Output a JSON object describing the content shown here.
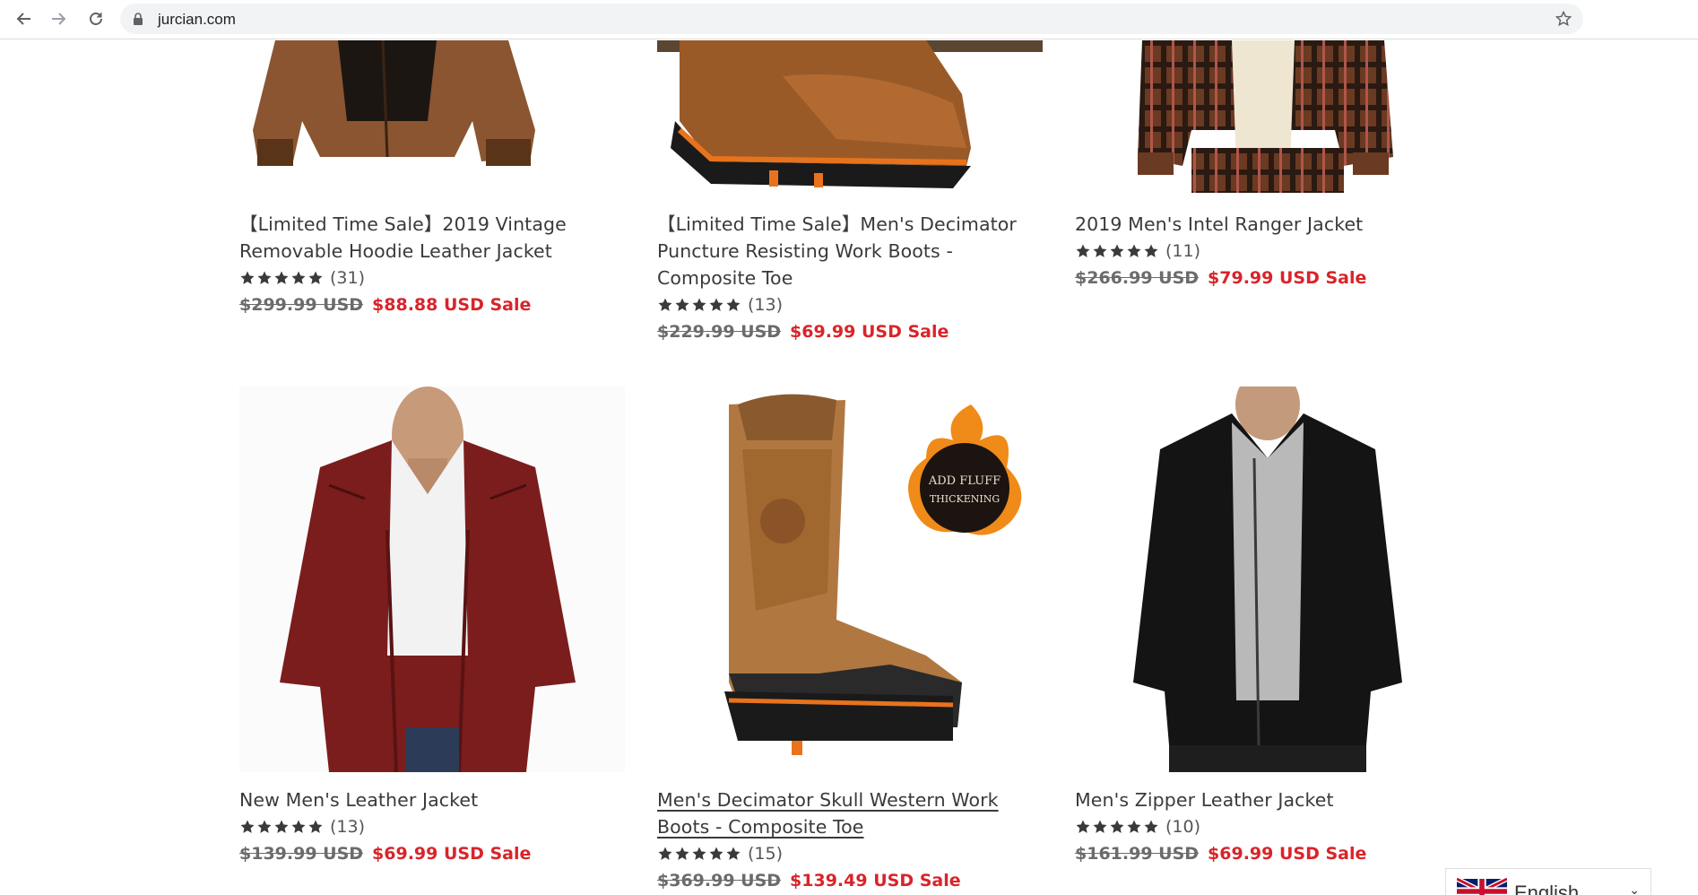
{
  "browser": {
    "url": "jurcian.com",
    "back_icon": "arrow-left-icon",
    "forward_icon": "arrow-right-icon",
    "reload_icon": "reload-icon",
    "lock_icon": "lock-icon",
    "bookmark_icon": "star-outline-icon"
  },
  "products": [
    {
      "title": "【Limited Time Sale】2019 Vintage Removable Hoodie Leather Jacket",
      "rating": 5,
      "reviews": "(31)",
      "was": "$299.99 USD",
      "now": "$88.88 USD Sale"
    },
    {
      "title": "【Limited Time Sale】Men's Decimator Puncture Resisting Work Boots - Composite Toe",
      "rating": 5,
      "reviews": "(13)",
      "was": "$229.99 USD",
      "now": "$69.99 USD Sale"
    },
    {
      "title": "2019 Men's Intel Ranger Jacket",
      "rating": 5,
      "reviews": "(11)",
      "was": "$266.99 USD",
      "now": "$79.99 USD Sale"
    },
    {
      "title": "New Men's Leather Jacket",
      "rating": 5,
      "reviews": "(13)",
      "was": "$139.99 USD",
      "now": "$69.99 USD Sale"
    },
    {
      "title": "Men's Decimator Skull Western Work Boots - Composite Toe",
      "rating": 5,
      "reviews": "(15)",
      "was": "$369.99 USD",
      "now": "$139.49 USD Sale",
      "badge_line1": "ADD FLUFF",
      "badge_line2": "THICKENING"
    },
    {
      "title": "Men's Zipper Leather Jacket",
      "rating": 5,
      "reviews": "(10)",
      "was": "$161.99 USD",
      "now": "$69.99 USD Sale"
    }
  ],
  "language": {
    "label": "English",
    "flag_icon": "uk-flag-icon",
    "caret_icon": "chevron-down-icon"
  },
  "colors": {
    "sale": "#d9242a",
    "text": "#3a3a3a",
    "star": "#3a3a3a"
  }
}
